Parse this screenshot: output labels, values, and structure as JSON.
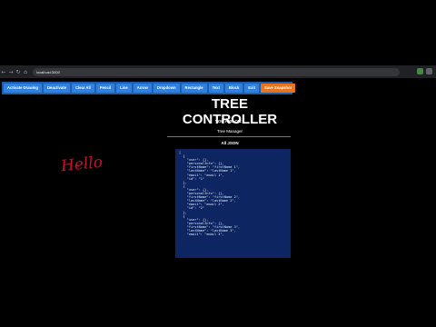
{
  "browser": {
    "url": "localhost:3000"
  },
  "toolbar": {
    "buttons": [
      "Activate Drawing",
      "Deactivate",
      "Clear All",
      "Pencil",
      "Line",
      "Arrow",
      "Dropdown",
      "Rectangle",
      "Text",
      "Block",
      "Exit"
    ],
    "save_label": "Save Snapshot"
  },
  "page": {
    "title": "TREE CONTROLLER",
    "location_line": "YOU ARE ON: /",
    "section": "Tree Manager",
    "json_heading": "All JSON",
    "json_text": "[\n  {\n    \"user\": {},\n    \"personalInfo\": {},\n    \"firstName\": \"firstName 1\",\n    \"lastName\": \"lastName 1\",\n    \"email\": \"email 1\",\n    \"id\": \"1\"\n  },\n  {\n    \"user\": {},\n    \"personalInfo\": {},\n    \"firstName\": \"firstName 2\",\n    \"lastName\": \"lastName 2\",\n    \"email\": \"email 2\",\n    \"id\": \"2\"\n  },\n  {\n    \"user\": {},\n    \"personalInfo\": {},\n    \"firstName\": \"firstName 3\",\n    \"lastName\": \"lastName 3\",\n    \"email\": \"email 3\","
  },
  "drawing": {
    "annotation_text": "Hello"
  }
}
